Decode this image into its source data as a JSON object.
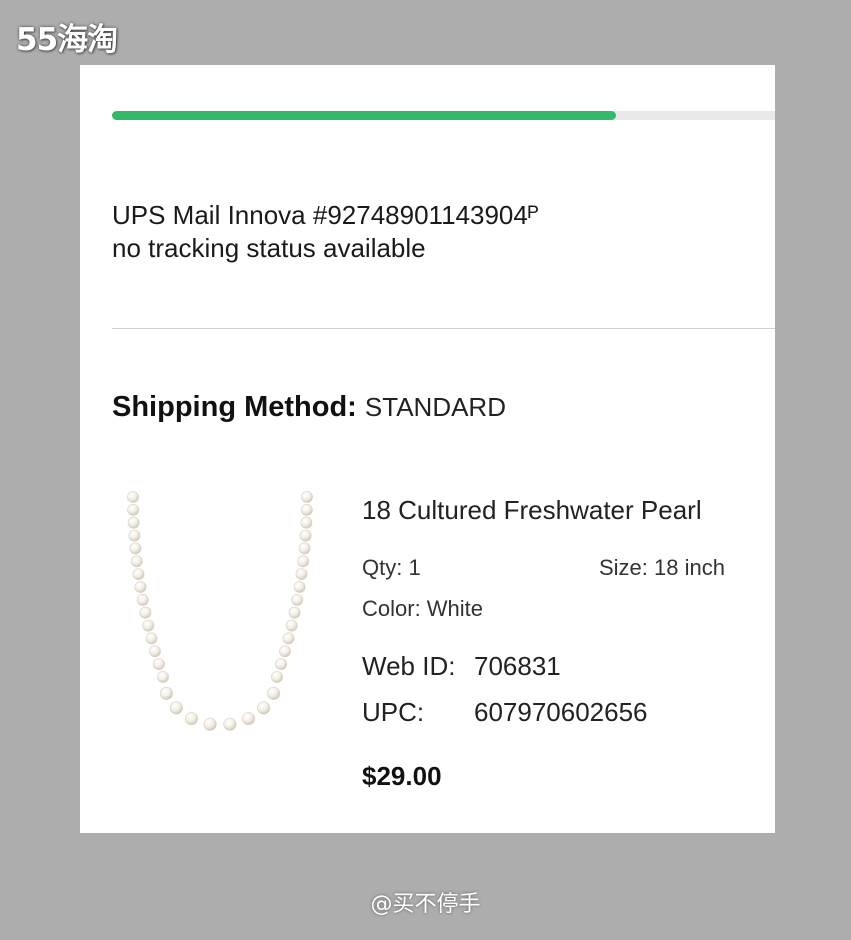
{
  "watermarks": {
    "top": "55海淘",
    "bottom": "@买不停手"
  },
  "order": {
    "progress_percent": 76,
    "progress_color": "#34b96b",
    "tracking": {
      "carrier_line": "UPS Mail Innova #92748901143904ᴾ",
      "status": "no tracking status available"
    },
    "shipping": {
      "label": "Shipping Method:",
      "value": "STANDARD"
    },
    "item": {
      "image": "pearl-necklace-image",
      "name": "18 Cultured Freshwater Pearl",
      "qty": "Qty: 1",
      "size": "Size: 18 inch",
      "color": "Color: White",
      "web_id_label": "Web ID:",
      "web_id": "706831",
      "upc_label": "UPC:",
      "upc": "607970602656",
      "price": "$29.00"
    }
  }
}
